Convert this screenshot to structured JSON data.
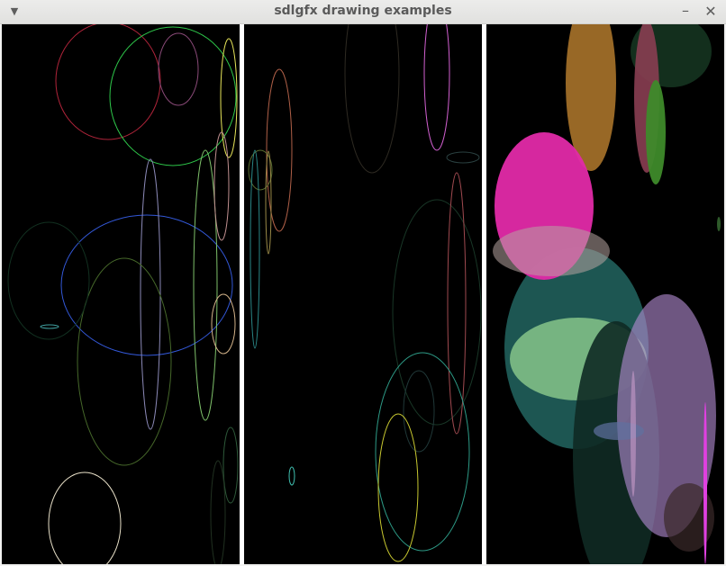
{
  "window": {
    "title": "sdlgfx drawing examples",
    "menu_icon": "triangle-down-icon",
    "minimize_icon": "minimize-icon",
    "close_icon": "close-icon"
  },
  "panels": [
    {
      "name": "ellipse-outline-panel",
      "style": "outline"
    },
    {
      "name": "antialiased-ellipse-panel",
      "style": "aa-outline"
    },
    {
      "name": "filled-ellipse-panel",
      "style": "filled"
    }
  ],
  "colors": {
    "titlebar_text": "#5a5a5a",
    "canvas_background": "#000000",
    "panel_divider": "#ffffff"
  }
}
